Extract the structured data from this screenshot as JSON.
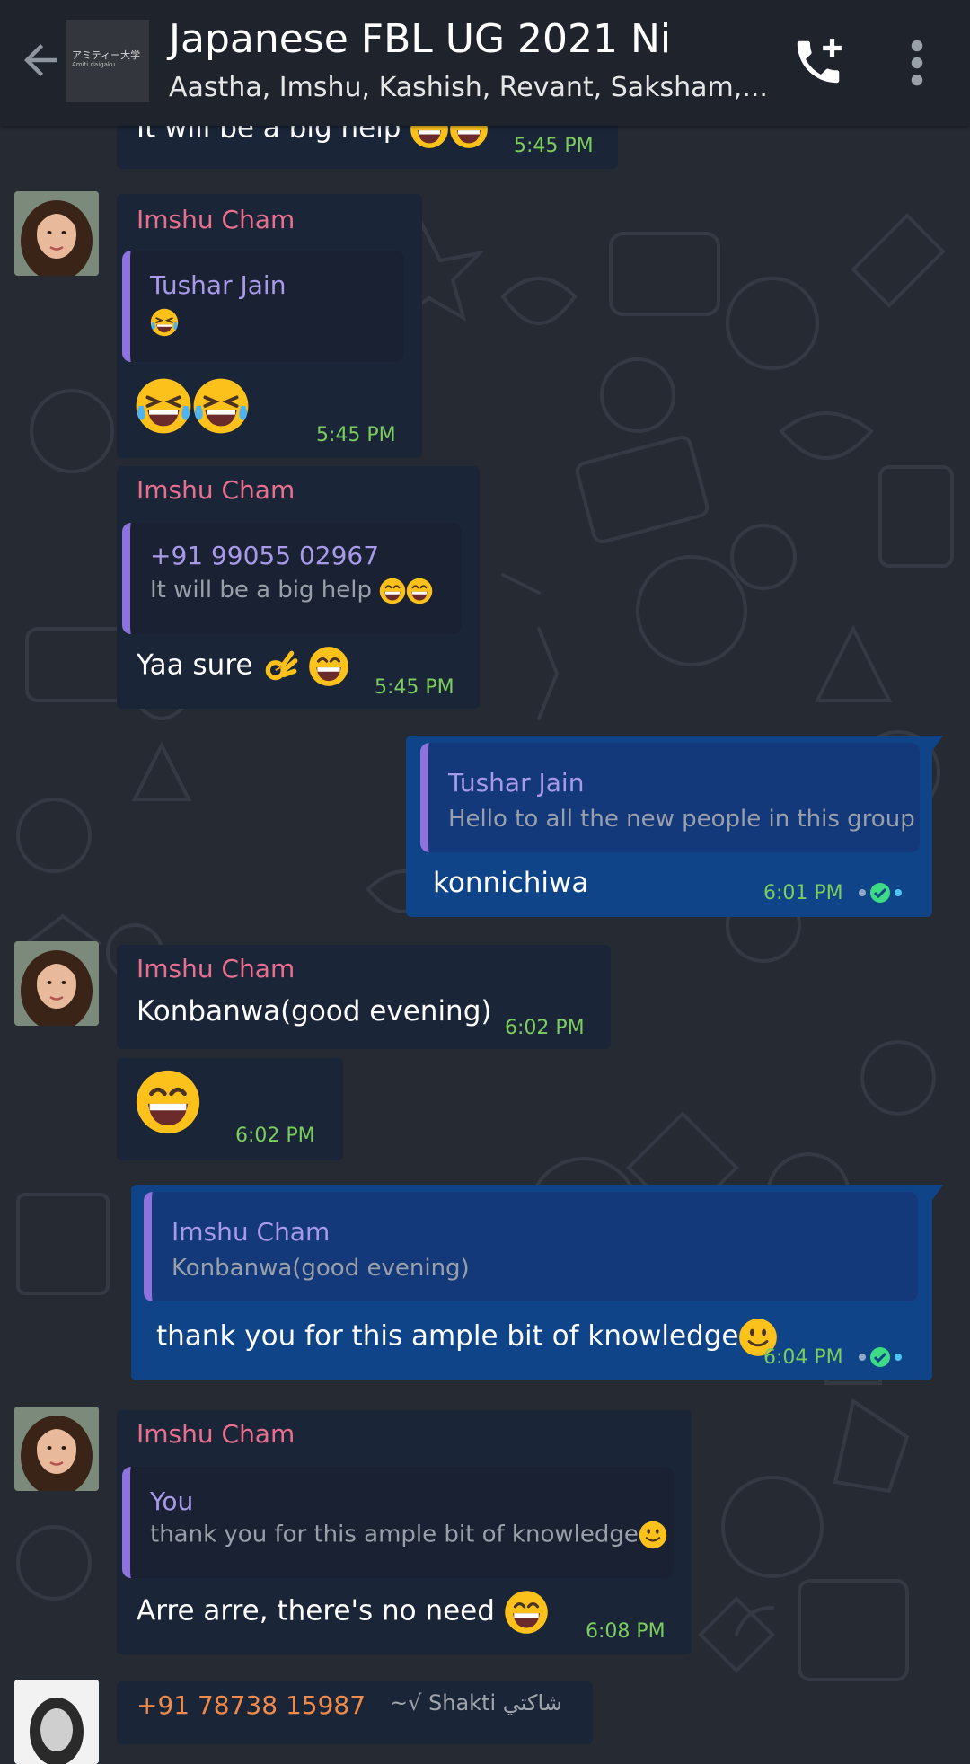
{
  "header": {
    "title": "Japanese FBL UG 2021 Ni",
    "subtitle": "Aastha, Imshu, Kashish, Revant, Saksham,...",
    "group_icon_line1": "アミティー大学",
    "group_icon_line2": "Amiti daigaku"
  },
  "messages": {
    "m0": {
      "text": "It will be a big help",
      "time": "5:45 PM"
    },
    "m1": {
      "sender": "Imshu Cham",
      "quote_name": "Tushar Jain",
      "time": "5:45 PM"
    },
    "m2": {
      "sender": "Imshu Cham",
      "quote_name": "+91 99055 02967",
      "quote_text": "It will be a big help",
      "text": "Yaa sure",
      "time": "5:45 PM"
    },
    "m3": {
      "quote_name": "Tushar Jain",
      "quote_text": "Hello to all the new people in this group",
      "text": "konnichiwa",
      "time": "6:01 PM"
    },
    "m4": {
      "sender": "Imshu Cham",
      "text": "Konbanwa(good evening)",
      "time": "6:02 PM"
    },
    "m5": {
      "time": "6:02 PM"
    },
    "m6": {
      "quote_name": "Imshu Cham",
      "quote_text": "Konbanwa(good evening)",
      "text": "thank you for this ample bit of knowledge",
      "time": "6:04 PM"
    },
    "m7": {
      "sender": "Imshu Cham",
      "quote_name": "You",
      "quote_text": "thank you for this ample bit of knowledge",
      "text": "Arre arre, there's no need",
      "time": "6:08 PM"
    },
    "m8": {
      "sender": "+91 78738 15987",
      "sender_alias": "~√ Shakti  شاكتي"
    }
  },
  "colors": {
    "incoming_bubble": "#1b2538",
    "outgoing_bubble": "#0f4488",
    "sender_name": "#e8708f",
    "quote_name": "#a79ae8",
    "timestamp": "#7bcd5e",
    "read_tick": "#3ddc84"
  },
  "icons": [
    "back-arrow-icon",
    "add-call-icon",
    "more-options-icon",
    "laughing-emoji",
    "grinning-emoji",
    "ok-hand-emoji",
    "smiling-emoji",
    "read-receipt-icon"
  ]
}
